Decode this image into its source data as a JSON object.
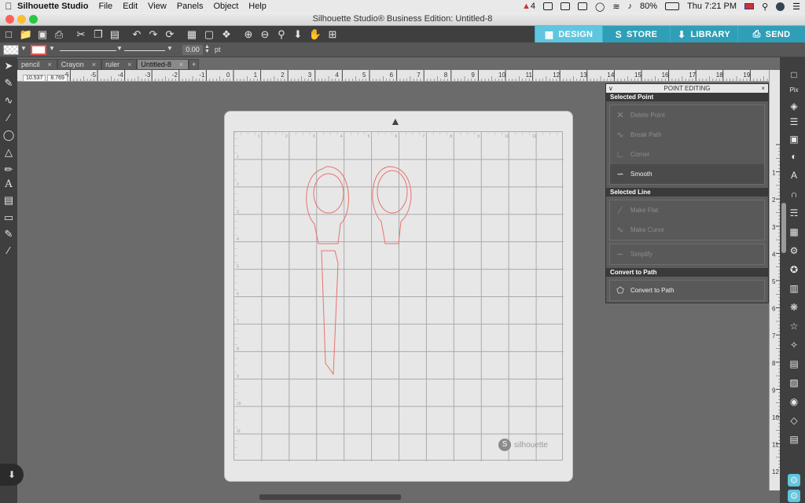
{
  "menubar": {
    "app_name": "Silhouette Studio",
    "items": [
      "File",
      "Edit",
      "View",
      "Panels",
      "Object",
      "Help"
    ],
    "notification_count": "4",
    "battery": "80%",
    "clock": "Thu 7:21 PM"
  },
  "window": {
    "title": "Silhouette Studio® Business Edition: Untitled-8"
  },
  "nav_tabs": [
    {
      "label": "DESIGN",
      "icon": "grid-icon"
    },
    {
      "label": "STORE",
      "icon": "store-icon"
    },
    {
      "label": "LIBRARY",
      "icon": "library-icon"
    },
    {
      "label": "SEND",
      "icon": "send-icon"
    }
  ],
  "toolbar2": {
    "line_width": "0.00",
    "unit": "pt"
  },
  "doc_tabs": [
    {
      "label": "pencil"
    },
    {
      "label": "Crayon"
    },
    {
      "label": "ruler"
    },
    {
      "label": "Untitled-8"
    }
  ],
  "add_tab": "+",
  "close_glyph": "×",
  "coords": {
    "x": "10.537",
    "y": "8.769"
  },
  "hruler_labels": [
    "-6",
    "-5",
    "-4",
    "-3",
    "-2",
    "-1",
    "0",
    "1",
    "2",
    "3",
    "4",
    "5",
    "6",
    "7",
    "8",
    "9",
    "10",
    "11",
    "12",
    "13",
    "14",
    "15",
    "16",
    "17",
    "18",
    "19"
  ],
  "vruler_labels": [
    "1",
    "2",
    "3",
    "4",
    "5",
    "6",
    "7",
    "8",
    "9",
    "10",
    "11",
    "12"
  ],
  "mat_top_labels": [
    "1",
    "2",
    "3",
    "4",
    "5",
    "6",
    "7",
    "8",
    "9",
    "10",
    "11"
  ],
  "mat_left_labels": [
    "1",
    "2",
    "3",
    "4",
    "5",
    "6",
    "7",
    "8",
    "9",
    "10",
    "11"
  ],
  "brand": "silhouette",
  "panel": {
    "title": "POINT EDITING",
    "sections": {
      "selected_point": "Selected Point",
      "selected_line": "Selected Line",
      "convert": "Convert to Path"
    },
    "buttons": {
      "delete_point": "Delete Point",
      "break_path": "Break Path",
      "corner": "Corner",
      "smooth": "Smooth",
      "make_flat": "Make Flat",
      "make_curve": "Make Curve",
      "simplify": "Simplify",
      "convert_to_path": "Convert to Path"
    }
  },
  "colors": {
    "accent": "#2f9fb8",
    "active_tab": "#5fc6e0",
    "cut_line": "#e8736d"
  }
}
